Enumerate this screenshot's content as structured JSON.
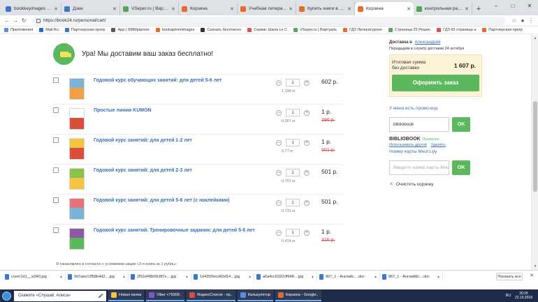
{
  "browser": {
    "tabs": [
      {
        "title": "bookkeyimages | Book24",
        "fav": "#3b78c9"
      },
      {
        "title": "Дзен",
        "fav": "#3b78c9"
      },
      {
        "title": "VSeper.ru | Виртуальный",
        "fav": "#5aa55a"
      },
      {
        "title": "Корзина",
        "fav": "#e56b2f"
      },
      {
        "title": "Учебная литература",
        "fav": "#e56b2f"
      },
      {
        "title": "Купить книги в интернет",
        "fav": "#e56b2f"
      },
      {
        "title": "Корзина",
        "fav": "#e56b2f",
        "active": true
      },
      {
        "title": "контрольная работа по",
        "fav": "#5aa55a"
      }
    ],
    "url": "https://book24.ru/personal/cart/",
    "bookmarks": [
      {
        "label": "Приложения",
        "fav": "#5b8fd9"
      },
      {
        "label": "Mail.Ru",
        "fav": "#1e6fc9"
      },
      {
        "label": "Партнерская прогр",
        "fav": "#3b78c9"
      },
      {
        "label": "App | SMMplanner",
        "fav": "#5a5a5a"
      },
      {
        "label": "bookaptreinimages",
        "fav": "#e56b2f"
      },
      {
        "label": "Скачать бесплатно",
        "fav": "#333333"
      },
      {
        "label": "Сервис Шала Le C",
        "fav": "#d9534f"
      },
      {
        "label": "VSeper.ru | Виртуаль",
        "fav": "#5aa55a"
      },
      {
        "label": "ГДЗ Литературное",
        "fav": "#e56b2f"
      },
      {
        "label": "Страница 25 Решен",
        "fav": "#5aa55a"
      },
      {
        "label": "ГДЗ 65 страница а",
        "fav": "#d9534f"
      },
      {
        "label": "Партнерская прогр",
        "fav": "#e56b2f"
      }
    ],
    "toolbar_icons": {
      "back": "back-arrow-icon",
      "forward": "forward-arrow-icon",
      "reload": "reload-icon",
      "star": "star-icon",
      "menu": "menu-icon"
    }
  },
  "page": {
    "banner": {
      "text": "Ура! Мы доставим ваш заказ бесплатно!",
      "icon": "truck-icon",
      "color": "#5cb85c"
    },
    "items": [
      {
        "title": "Годовой курс обучающих занятий: для детей 5-6 лет",
        "qty": "1",
        "weight": "1,196 кг",
        "price": "602 р.",
        "old_price": "",
        "cover": [
          "#7ab2d8",
          "#f0a048"
        ]
      },
      {
        "title": "Простые линии KUMON",
        "qty": "1",
        "weight": "0,357 кг",
        "price": "1 р.",
        "old_price": "396 р.",
        "cover": [
          "#ffffff",
          "#d94f3a"
        ]
      },
      {
        "title": "Годовой курс занятий: для детей 1-2 лет",
        "qty": "1",
        "weight": "0,77 кг",
        "price": "1 р.",
        "old_price": "501 р.",
        "cover": [
          "#f4c542",
          "#d94f3a"
        ]
      },
      {
        "title": "Годовой курс занятий: для детей 2-3 лет",
        "qty": "1",
        "weight": "0,707 кг",
        "price": "501 р.",
        "old_price": "",
        "cover": [
          "#8bc34a",
          "#f4c542"
        ]
      },
      {
        "title": "Годовой курс занятий: для детей 5-6 лет (с наклейками)",
        "qty": "1",
        "weight": "0,731 кг",
        "price": "501 р.",
        "old_price": "",
        "cover": [
          "#e57373",
          "#7ab2d8"
        ]
      },
      {
        "title": "Годовой курс занятий. Тренировочные задания: для детей 5-6 лет",
        "qty": "1",
        "weight": "0,414 кг",
        "price": "1 р.",
        "old_price": "315 р.",
        "cover": [
          "#8e5aa8",
          "#5cb85c"
        ]
      }
    ],
    "qty_minus": "–",
    "qty_plus": "+",
    "agree_text": "Я ознакомлен и согласен с условиями акции «3-я книга за 1 рубль»"
  },
  "sidebar": {
    "delivery_label": "Доставка в",
    "delivery_city": "Александрия",
    "delivery_note": "Передадим в службу доставки 24 октября",
    "total_label": "Итоговая сумма без доставки",
    "total_value": "1 607 р.",
    "order_button": "Оформить заказ",
    "promo_link": "У меня есть промо-код",
    "promo_value": "bibliobook",
    "ok_label": "OK",
    "coupon_code": "BIBLIOBOOK",
    "coupon_status": "Применен",
    "coupon_used": "Использовать другой",
    "coupon_remove": "Удалить",
    "card_link": "Номер карты Много.ру",
    "card_placeholder": "Введите номер карты Много.ру",
    "clear_cart": "Очистить корзину"
  },
  "downloads": {
    "files": [
      {
        "name": "cover1d1__w340.jpg"
      },
      {
        "name": "9d7aee13f58b4d2....jpg"
      },
      {
        "name": "2f52ef48b5fc8f7e....jpg"
      },
      {
        "name": "1d435f9ecd43d14....jpg"
      },
      {
        "name": "a6a4cc6322cff948....jpg"
      },
      {
        "name": "807_1 - Английс....doc"
      },
      {
        "name": "867_1 - Английйс....doc"
      }
    ],
    "show_all": "Показать все"
  },
  "taskbar": {
    "search_text": "Скажите «Слушай, Алиса»",
    "apps": [
      {
        "label": "Новая папка",
        "color": "#f4c542"
      },
      {
        "label": "Viber +79309..",
        "color": "#7e57c2"
      },
      {
        "label": "ЯндексСписок - пр..",
        "color": "#d94f3a"
      },
      {
        "label": "Калькулятор",
        "color": "#5b8fd9"
      },
      {
        "label": "Корзина - Google..",
        "color": "#e56b2f"
      }
    ],
    "time": "20:26",
    "date": "22.10.2018",
    "lang": "RU"
  }
}
